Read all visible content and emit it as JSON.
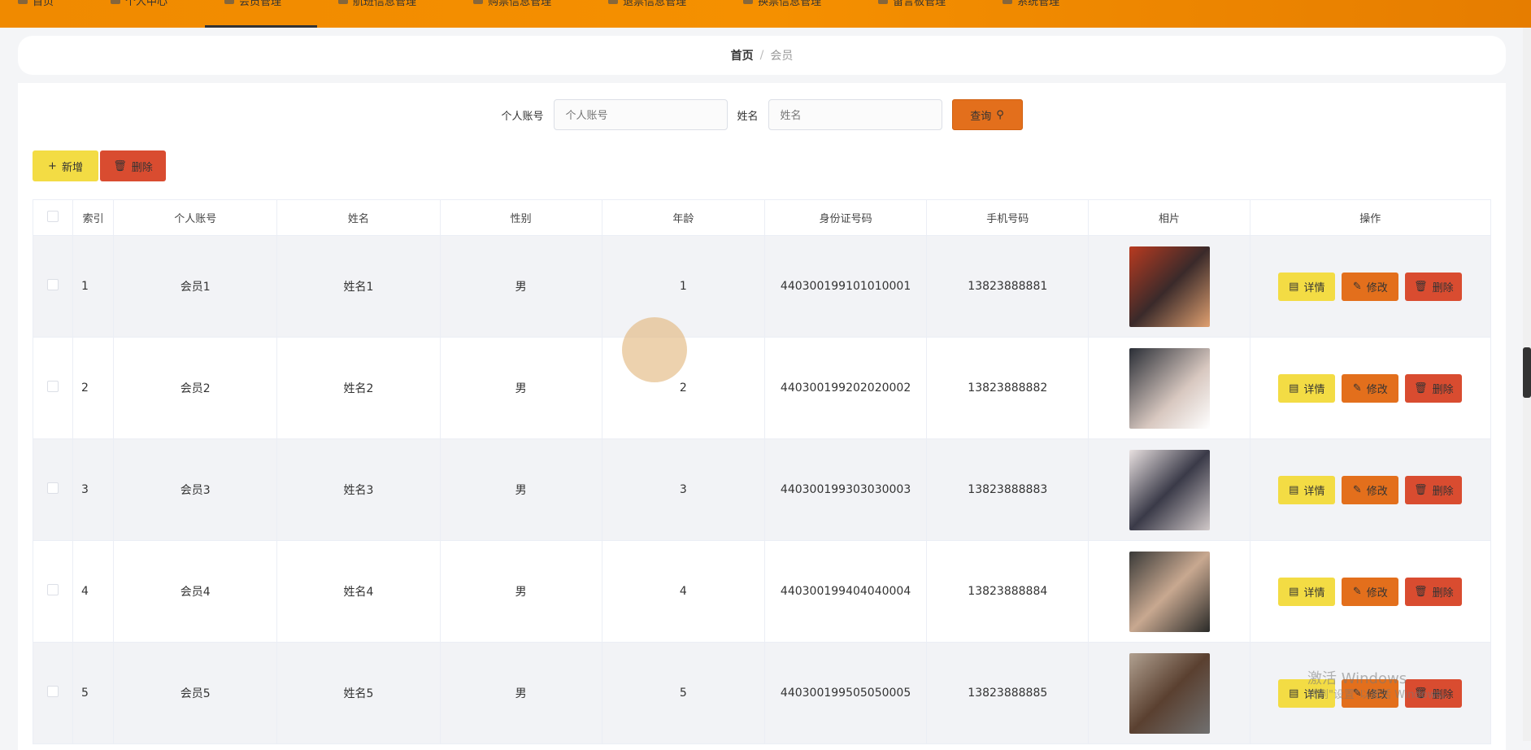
{
  "nav": [
    {
      "label": "首页",
      "icon": "home-icon"
    },
    {
      "label": "个人中心",
      "icon": "user-icon"
    },
    {
      "label": "会员管理",
      "icon": "member-icon",
      "active": true
    },
    {
      "label": "航班信息管理",
      "icon": "list-icon"
    },
    {
      "label": "购票信息管理",
      "icon": "list-icon"
    },
    {
      "label": "退票信息管理",
      "icon": "doc-icon"
    },
    {
      "label": "换票信息管理",
      "icon": "pin-icon"
    },
    {
      "label": "留言板管理",
      "icon": "doc-icon"
    },
    {
      "label": "系统管理",
      "icon": "gear-icon"
    }
  ],
  "breadcrumb": {
    "home": "首页",
    "sep": "/",
    "current": "会员"
  },
  "search": {
    "account_label": "个人账号",
    "account_placeholder": "个人账号",
    "name_label": "姓名",
    "name_placeholder": "姓名",
    "query": "查询"
  },
  "actions": {
    "add": "新增",
    "delete": "删除"
  },
  "table": {
    "headers": [
      "索引",
      "个人账号",
      "姓名",
      "性别",
      "年龄",
      "身份证号码",
      "手机号码",
      "相片",
      "操作"
    ],
    "rows": [
      {
        "idx": "1",
        "account": "会员1",
        "name": "姓名1",
        "gender": "男",
        "age": "1",
        "id": "440300199101010001",
        "phone": "13823888881"
      },
      {
        "idx": "2",
        "account": "会员2",
        "name": "姓名2",
        "gender": "男",
        "age": "2",
        "id": "440300199202020002",
        "phone": "13823888882"
      },
      {
        "idx": "3",
        "account": "会员3",
        "name": "姓名3",
        "gender": "男",
        "age": "3",
        "id": "440300199303030003",
        "phone": "13823888883"
      },
      {
        "idx": "4",
        "account": "会员4",
        "name": "姓名4",
        "gender": "男",
        "age": "4",
        "id": "440300199404040004",
        "phone": "13823888884"
      },
      {
        "idx": "5",
        "account": "会员5",
        "name": "姓名5",
        "gender": "男",
        "age": "5",
        "id": "440300199505050005",
        "phone": "13823888885"
      }
    ],
    "ops": {
      "detail": "详情",
      "edit": "修改",
      "delete": "删除"
    }
  },
  "watermark": {
    "line1": "激活 Windows",
    "line2": "转到\"设置\"以激活 Windows。"
  },
  "colors": {
    "nav": "#f59000",
    "yellow": "#f3dc44",
    "orange": "#e36f1c",
    "red": "#d94c30"
  }
}
